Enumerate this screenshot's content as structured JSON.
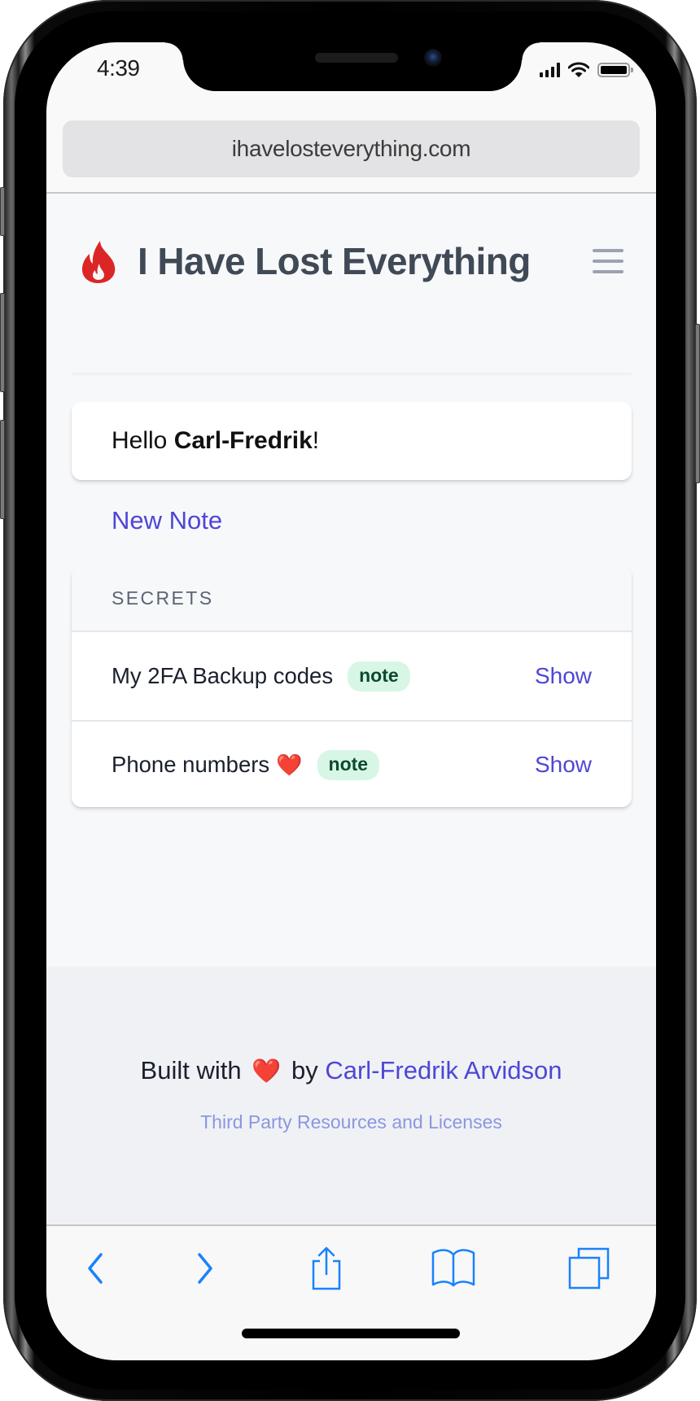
{
  "status_bar": {
    "time": "4:39",
    "icons": [
      "cellular-signal-icon",
      "wifi-icon",
      "battery-icon"
    ]
  },
  "browser": {
    "url": "ihavelosteverything.com",
    "toolbar": [
      {
        "name": "back",
        "icon": "chevron-left-icon"
      },
      {
        "name": "forward",
        "icon": "chevron-right-icon"
      },
      {
        "name": "share",
        "icon": "share-icon"
      },
      {
        "name": "bookmarks",
        "icon": "book-icon"
      },
      {
        "name": "tabs",
        "icon": "tabs-icon"
      }
    ]
  },
  "header": {
    "logo_icon": "flame-icon",
    "title": "I Have Lost Everything",
    "menu_icon": "hamburger-menu-icon"
  },
  "greeting": {
    "prefix": "Hello ",
    "name": "Carl-Fredrik",
    "suffix": "!"
  },
  "new_note_label": "New Note",
  "secrets": {
    "heading": "SECRETS",
    "items": [
      {
        "title": "My 2FA Backup codes",
        "emoji": "",
        "badge": "note",
        "action": "Show"
      },
      {
        "title": "Phone numbers",
        "emoji": "❤️",
        "badge": "note",
        "action": "Show"
      }
    ]
  },
  "footer": {
    "built_prefix": "Built with",
    "heart": "❤️",
    "built_by": "by",
    "author": "Carl-Fredrik Arvidson",
    "licenses": "Third Party Resources and Licenses"
  },
  "colors": {
    "brand_red": "#dc2626",
    "link": "#4f46d5",
    "title": "#404a57",
    "badge_bg": "#d8f6e6",
    "badge_text": "#0c4a2e",
    "ios_blue": "#1a82fb"
  }
}
